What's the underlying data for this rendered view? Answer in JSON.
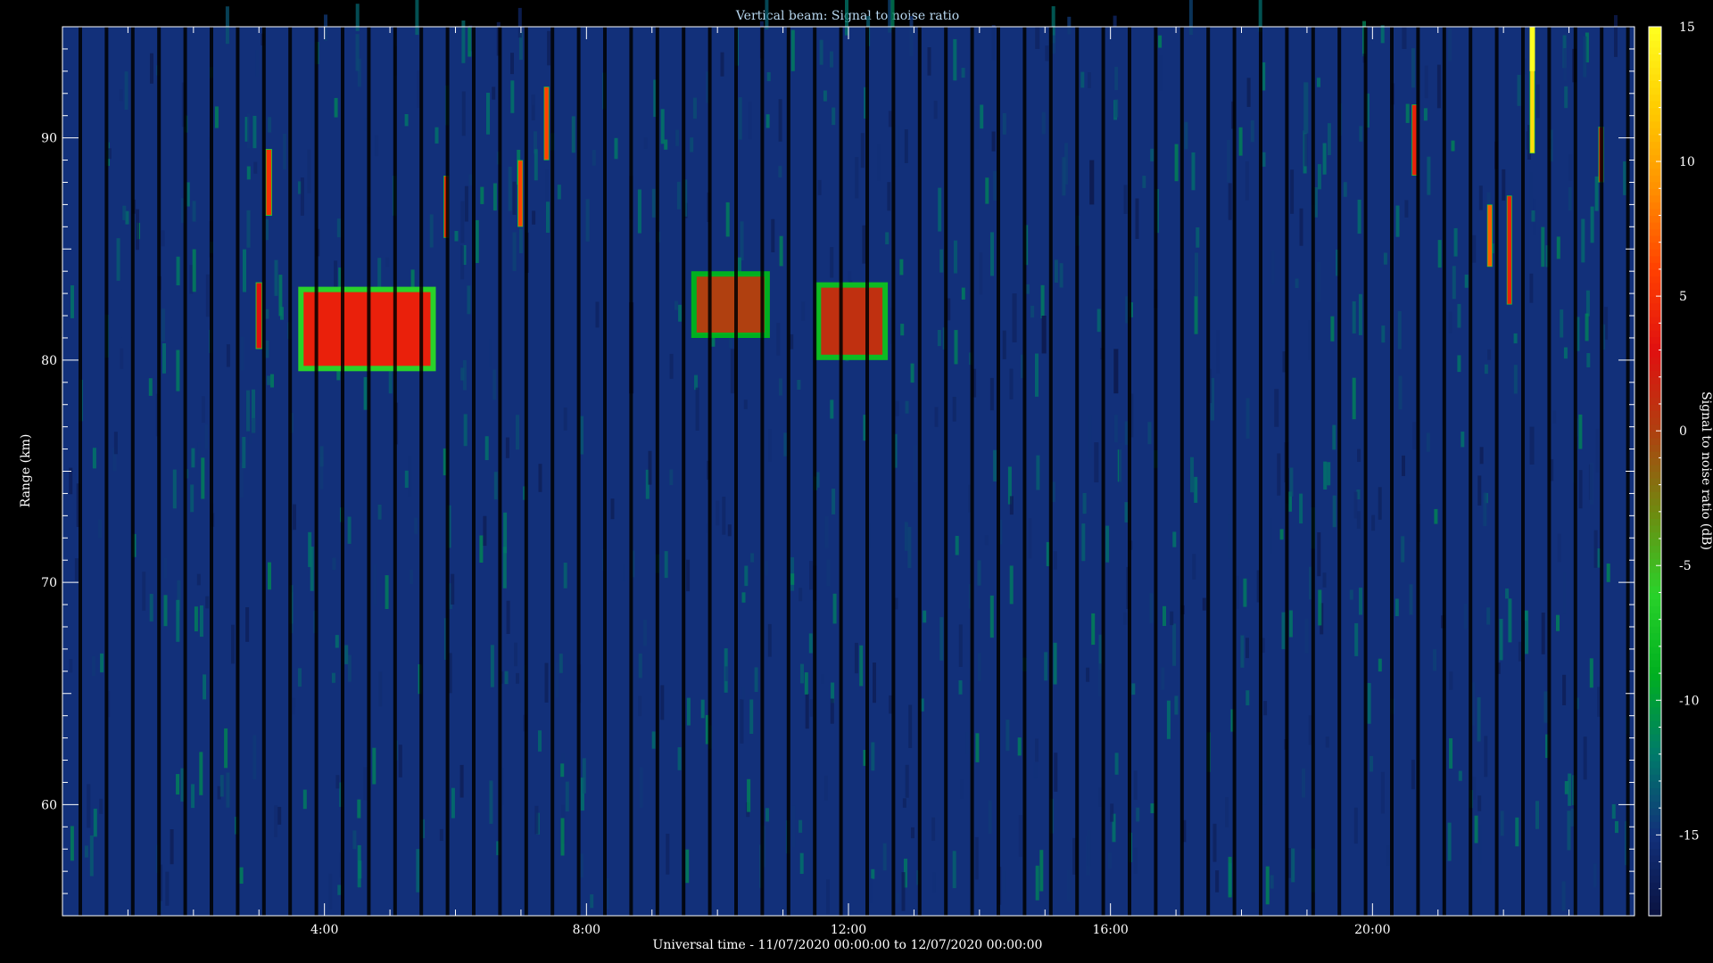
{
  "chart_data": {
    "type": "heatmap",
    "title": "Vertical beam: Signal to noise ratio",
    "xlabel": "Universal time - 11/07/2020 00:00:00 to 12/07/2020 00:00:00",
    "ylabel": "Range (km)",
    "colorbar_label": "Signal to noise ratio (dB)",
    "x_unit": "hours UT",
    "xlim": [
      0,
      24
    ],
    "ylim": [
      55,
      95
    ],
    "clim": [
      -18,
      15
    ],
    "x_ticks": [
      {
        "value": 4,
        "label": "4:00"
      },
      {
        "value": 8,
        "label": "8:00"
      },
      {
        "value": 12,
        "label": "12:00"
      },
      {
        "value": 16,
        "label": "16:00"
      },
      {
        "value": 20,
        "label": "20:00"
      }
    ],
    "y_ticks": [
      {
        "value": 60,
        "label": "60"
      },
      {
        "value": 70,
        "label": "70"
      },
      {
        "value": 80,
        "label": "80"
      },
      {
        "value": 90,
        "label": "90"
      }
    ],
    "colorbar_ticks": [
      {
        "value": 15,
        "label": "15"
      },
      {
        "value": 10,
        "label": "10"
      },
      {
        "value": 5,
        "label": "5"
      },
      {
        "value": 0,
        "label": "0"
      },
      {
        "value": -5,
        "label": "-5"
      },
      {
        "value": -10,
        "label": "-10"
      },
      {
        "value": -15,
        "label": "-15"
      }
    ],
    "colormap": [
      "#0a1240",
      "#12307a",
      "#007a6a",
      "#00b020",
      "#2ad22a",
      "#6f8a10",
      "#b04010",
      "#e01010",
      "#ff4000",
      "#ff9000",
      "#ffcc00",
      "#ffff20"
    ],
    "background_snr": -15,
    "features": [
      {
        "t0": 3.6,
        "t1": 5.7,
        "r0": 79.5,
        "r1": 83.3,
        "snr": 4
      },
      {
        "t0": 9.6,
        "t1": 10.8,
        "r0": 81.0,
        "r1": 84.0,
        "snr": 0
      },
      {
        "t0": 11.5,
        "t1": 12.6,
        "r0": 80.0,
        "r1": 83.5,
        "snr": 1
      },
      {
        "t0": 2.95,
        "t1": 3.05,
        "r0": 80.5,
        "r1": 83.5,
        "snr": 3
      },
      {
        "t0": 3.1,
        "t1": 3.2,
        "r0": 86.5,
        "r1": 89.5,
        "snr": 5
      },
      {
        "t0": 5.82,
        "t1": 5.9,
        "r0": 85.5,
        "r1": 88.3,
        "snr": 5
      },
      {
        "t0": 6.95,
        "t1": 7.03,
        "r0": 86.0,
        "r1": 89.0,
        "snr": 6
      },
      {
        "t0": 7.35,
        "t1": 7.43,
        "r0": 89.0,
        "r1": 92.3,
        "snr": 6
      },
      {
        "t0": 20.6,
        "t1": 20.68,
        "r0": 88.3,
        "r1": 91.5,
        "snr": 4
      },
      {
        "t0": 22.4,
        "t1": 22.48,
        "r0": 89.3,
        "r1": 95.0,
        "snr": 13
      },
      {
        "t0": 23.45,
        "t1": 23.53,
        "r0": 88.0,
        "r1": 90.5,
        "snr": 4
      },
      {
        "t0": 21.75,
        "t1": 21.83,
        "r0": 84.2,
        "r1": 87.0,
        "snr": 7
      },
      {
        "t0": 22.05,
        "t1": 22.13,
        "r0": 82.5,
        "r1": 87.4,
        "snr": 4
      },
      {
        "t0": 0.9,
        "t1": 0.97,
        "r0": 81.0,
        "r1": 83.2,
        "snr": -6
      },
      {
        "t0": 3.55,
        "t1": 3.62,
        "r0": 62.3,
        "r1": 64.4,
        "snr": -6
      },
      {
        "t0": 5.9,
        "t1": 5.97,
        "r0": 62.5,
        "r1": 64.6,
        "snr": -6
      },
      {
        "t0": 8.5,
        "t1": 8.57,
        "r0": 83.5,
        "r1": 85.8,
        "snr": -6
      },
      {
        "t0": 8.65,
        "t1": 8.72,
        "r0": 78.5,
        "r1": 82.6,
        "snr": -8
      },
      {
        "t0": 10.2,
        "t1": 10.27,
        "r0": 78.5,
        "r1": 80.5,
        "snr": -7
      },
      {
        "t0": 13.5,
        "t1": 13.57,
        "r0": 60.5,
        "r1": 62.8,
        "snr": -6
      },
      {
        "t0": 14.5,
        "t1": 14.57,
        "r0": 80.8,
        "r1": 83.0,
        "snr": -7
      },
      {
        "t0": 14.95,
        "t1": 15.02,
        "r0": 80.3,
        "r1": 82.0,
        "snr": -8
      },
      {
        "t0": 15.75,
        "t1": 15.82,
        "r0": 74.5,
        "r1": 76.3,
        "snr": -7
      },
      {
        "t0": 15.68,
        "t1": 15.75,
        "r0": 87.0,
        "r1": 89.0,
        "snr": -8
      },
      {
        "t0": 16.05,
        "t1": 16.12,
        "r0": 78.5,
        "r1": 80.5,
        "snr": -8
      },
      {
        "t0": 18.5,
        "t1": 18.57,
        "r0": 77.0,
        "r1": 78.7,
        "snr": -7
      },
      {
        "t0": 18.65,
        "t1": 18.72,
        "r0": 74.5,
        "r1": 76.3,
        "snr": -7
      },
      {
        "t0": 18.95,
        "t1": 19.02,
        "r0": 90.2,
        "r1": 92.5,
        "snr": -5
      },
      {
        "t0": 22.4,
        "t1": 22.47,
        "r0": 75.3,
        "r1": 77.0,
        "snr": -7
      },
      {
        "t0": 23.05,
        "t1": 23.12,
        "r0": 92.5,
        "r1": 94.0,
        "snr": -8
      },
      {
        "t0": 14.85,
        "t1": 14.92,
        "r0": 94.0,
        "r1": 95.0,
        "snr": -7
      },
      {
        "t0": 20.45,
        "t1": 20.52,
        "r0": 94.0,
        "r1": 95.0,
        "snr": -7
      }
    ]
  }
}
